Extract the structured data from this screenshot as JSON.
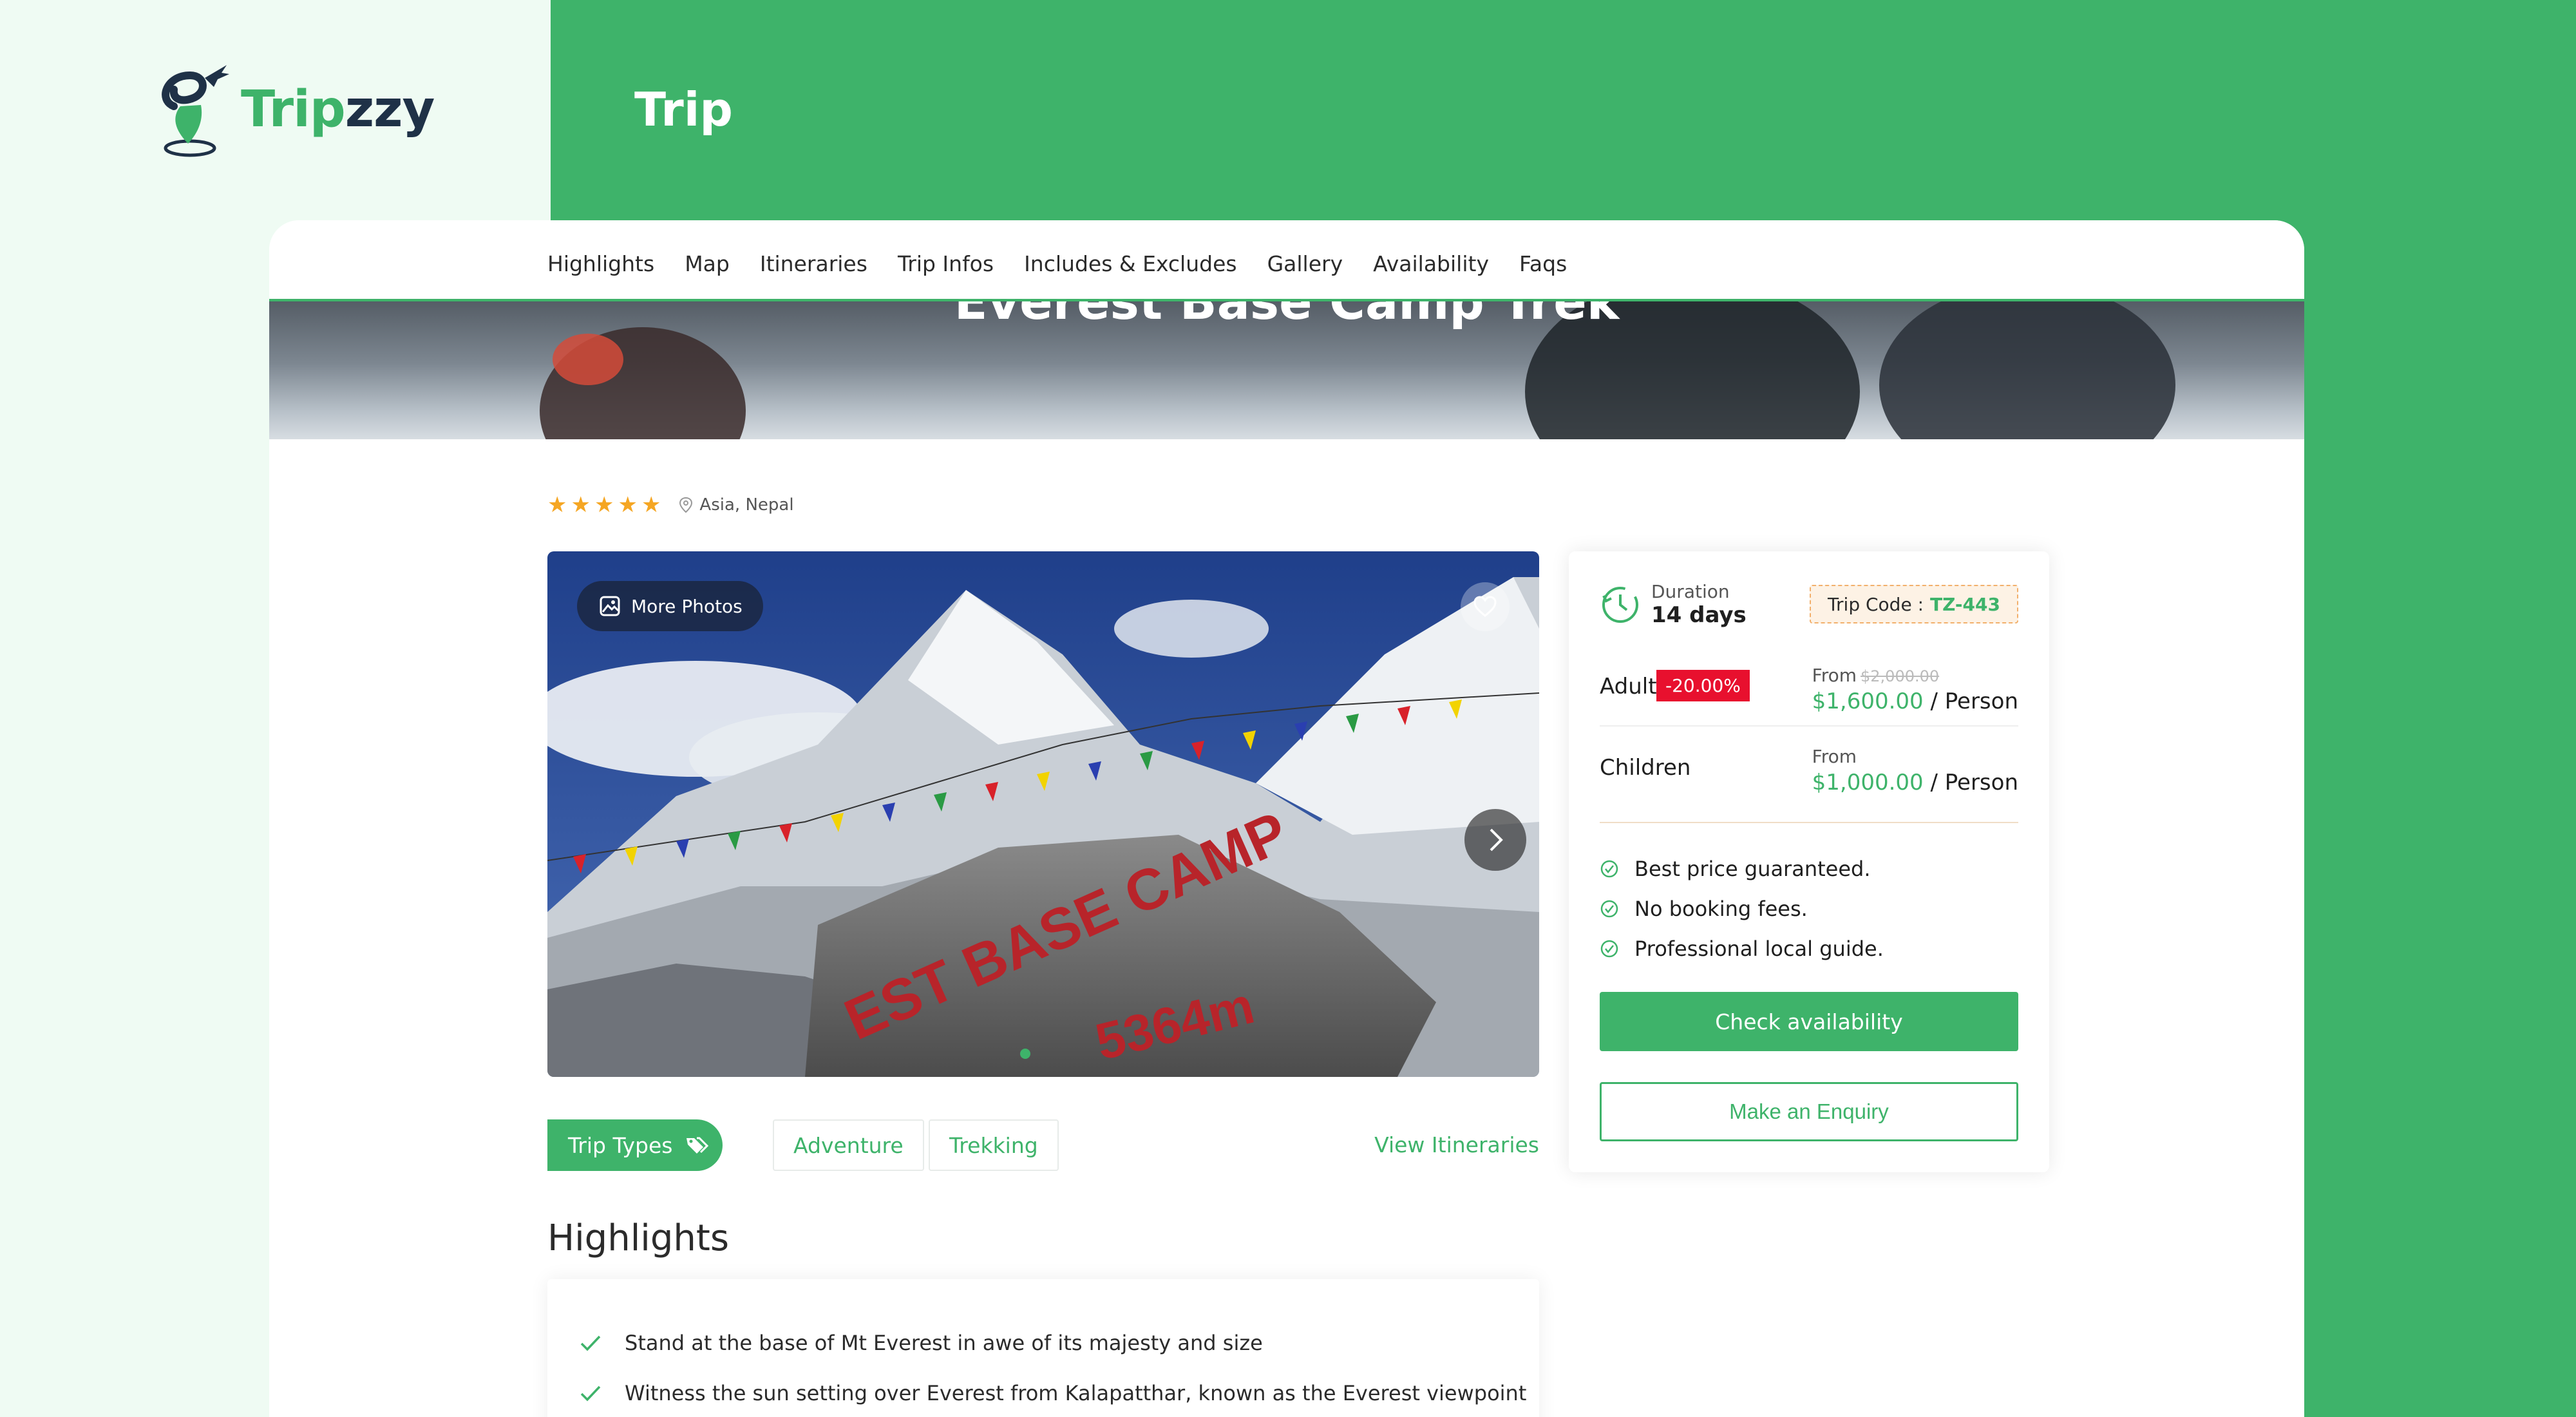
{
  "brand": {
    "name_part1": "Trip",
    "name_part2": "zzy",
    "accent_color": "#3eb36a",
    "dark_color": "#1f3147"
  },
  "header": {
    "title": "Trip"
  },
  "tabs": [
    {
      "label": "Highlights"
    },
    {
      "label": "Map"
    },
    {
      "label": "Itineraries"
    },
    {
      "label": "Trip Infos"
    },
    {
      "label": "Includes & Excludes"
    },
    {
      "label": "Gallery"
    },
    {
      "label": "Availability"
    },
    {
      "label": "Faqs"
    }
  ],
  "hero": {
    "title": "Everest Base Camp Trek"
  },
  "meta": {
    "rating": 5,
    "rating_icon": "star-icon",
    "location": "Asia, Nepal",
    "location_icon": "map-pin-icon"
  },
  "gallery": {
    "more_photos_label": "More Photos",
    "image_text_1": "EST BASE CAMP",
    "image_text_2": "5364m"
  },
  "trip_types": {
    "button_label": "Trip Types",
    "types": [
      "Adventure",
      "Trekking"
    ],
    "view_itineraries_label": "View Itineraries"
  },
  "highlights": {
    "title": "Highlights",
    "items": [
      "Stand at the base of Mt Everest in awe of its majesty and size",
      "Witness the sun setting over Everest from Kalapatthar, known as the Everest viewpoint"
    ]
  },
  "booking": {
    "duration_label": "Duration",
    "duration_value": "14 days",
    "trip_code_label": "Trip Code :",
    "trip_code": "TZ-443",
    "adult": {
      "label": "Adult",
      "discount": "-20.00%",
      "from_label": "From",
      "old_price": "$2,000.00",
      "price": "$1,600.00",
      "unit": "/ Person"
    },
    "children": {
      "label": "Children",
      "from_label": "From",
      "price": "$1,000.00",
      "unit": "/ Person"
    },
    "features": [
      "Best price guaranteed.",
      "No booking fees.",
      "Professional local guide."
    ],
    "check_availability_label": "Check availability",
    "enquiry_label": "Make an Enquiry"
  }
}
